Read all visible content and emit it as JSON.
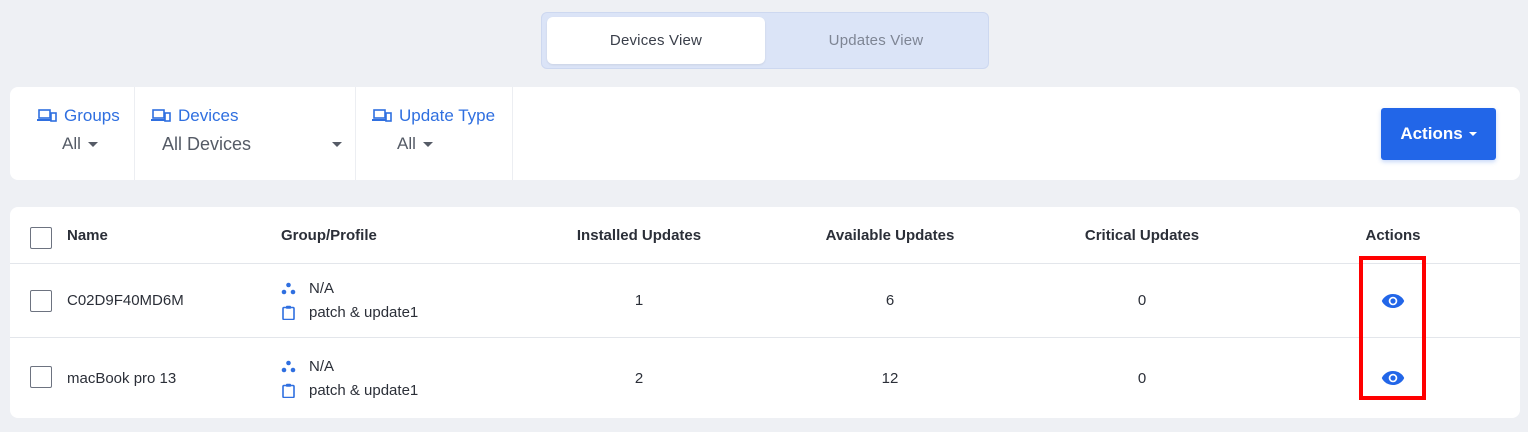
{
  "view_toggle": {
    "tabs": [
      {
        "label": "Devices View",
        "active": true
      },
      {
        "label": "Updates View",
        "active": false
      }
    ]
  },
  "filters": {
    "groups": {
      "label": "Groups",
      "value": "All"
    },
    "devices": {
      "label": "Devices",
      "value": "All Devices"
    },
    "update_type": {
      "label": "Update Type",
      "value": "All"
    }
  },
  "actions_button": {
    "label": "Actions"
  },
  "table": {
    "columns": [
      "Name",
      "Group/Profile",
      "Installed Updates",
      "Available Updates",
      "Critical Updates",
      "Actions"
    ],
    "rows": [
      {
        "name": "C02D9F40MD6M",
        "group": "N/A",
        "profile": "patch & update1",
        "installed": "1",
        "available": "6",
        "critical": "0"
      },
      {
        "name": "macBook pro 13",
        "group": "N/A",
        "profile": "patch & update1",
        "installed": "2",
        "available": "12",
        "critical": "0"
      }
    ]
  },
  "colors": {
    "accent": "#2266e8",
    "link_blue": "#2f6fe0",
    "highlight": "#ff0000",
    "background": "#eef0f4"
  },
  "icons": {
    "filter_icon": "devices-icon",
    "group_icon": "group-icon",
    "profile_icon": "clipboard-icon",
    "action_icon": "eye-icon"
  }
}
